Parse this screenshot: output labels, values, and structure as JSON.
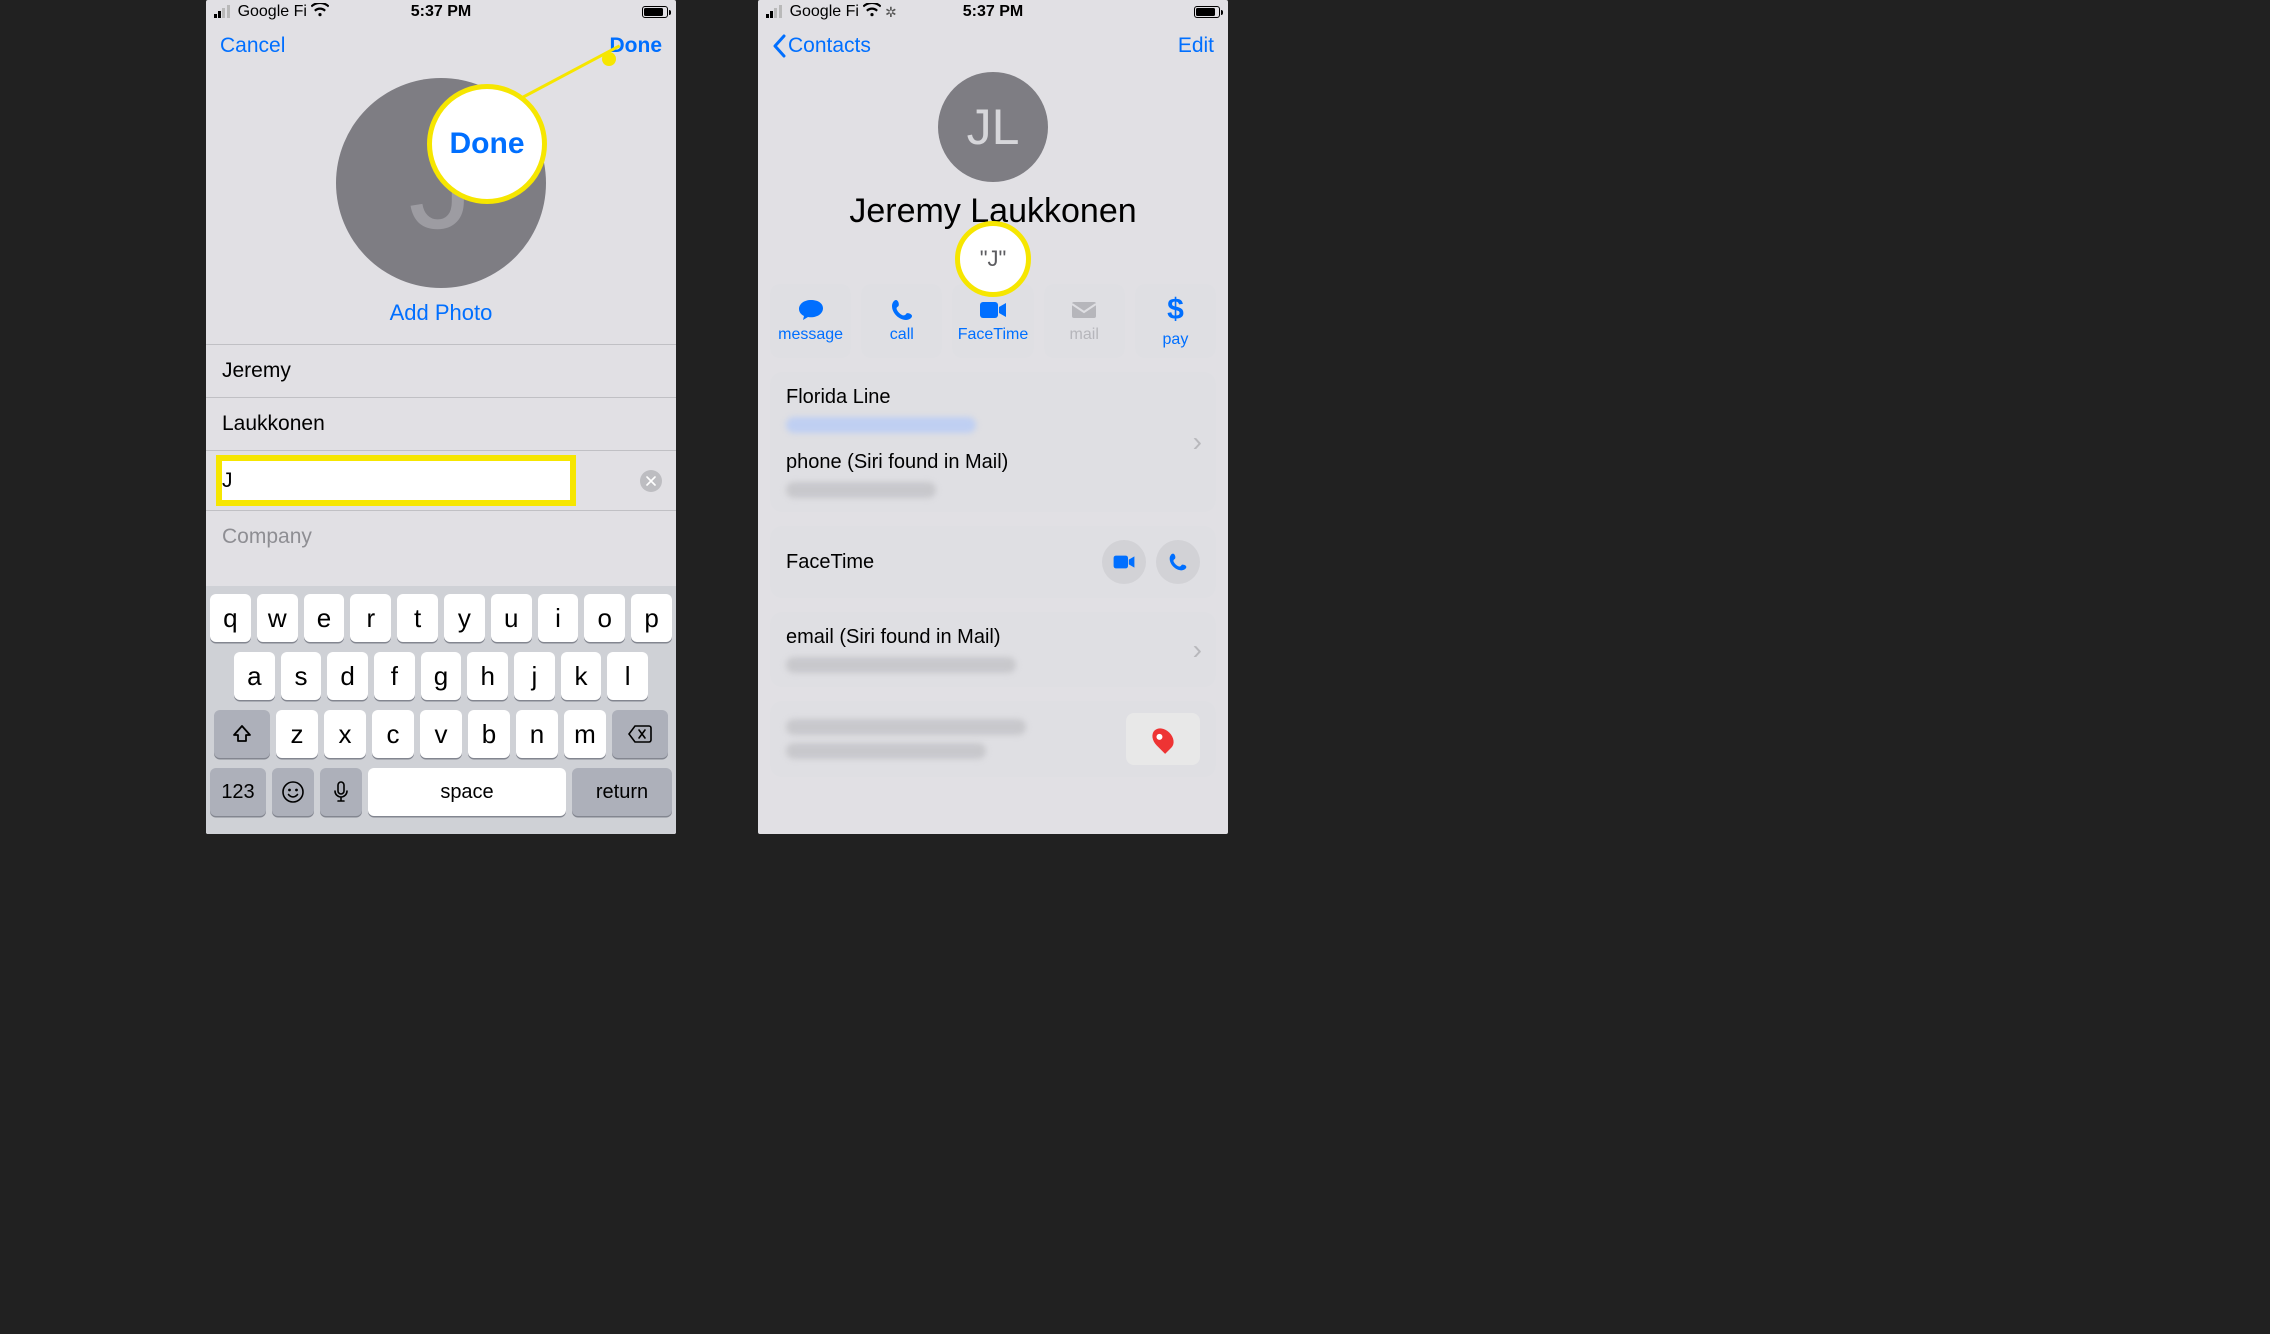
{
  "statusbar": {
    "carrier": "Google Fi",
    "time": "5:37 PM"
  },
  "left": {
    "nav": {
      "cancel": "Cancel",
      "done": "Done"
    },
    "addPhoto": "Add Photo",
    "avatarInitial": "J",
    "fields": {
      "first": "Jeremy",
      "last": "Laukkonen",
      "nickname": "J",
      "companyPlaceholder": "Company"
    },
    "keyboard": {
      "row1": [
        "q",
        "w",
        "e",
        "r",
        "t",
        "y",
        "u",
        "i",
        "o",
        "p"
      ],
      "row2": [
        "a",
        "s",
        "d",
        "f",
        "g",
        "h",
        "j",
        "k",
        "l"
      ],
      "row3": [
        "z",
        "x",
        "c",
        "v",
        "b",
        "n",
        "m"
      ],
      "nums": "123",
      "space": "space",
      "return": "return"
    },
    "callout": "Done"
  },
  "right": {
    "nav": {
      "back": "Contacts",
      "edit": "Edit"
    },
    "avatarInitials": "JL",
    "name": "Jeremy Laukkonen",
    "nickname": "\"J\"",
    "actions": {
      "message": "message",
      "call": "call",
      "facetime": "FaceTime",
      "mail": "mail",
      "pay": "pay"
    },
    "cards": {
      "phone1Label": "Florida Line",
      "phone2Label": "phone (Siri found in Mail)",
      "facetimeLabel": "FaceTime",
      "emailLabel": "email (Siri found in Mail)"
    }
  }
}
